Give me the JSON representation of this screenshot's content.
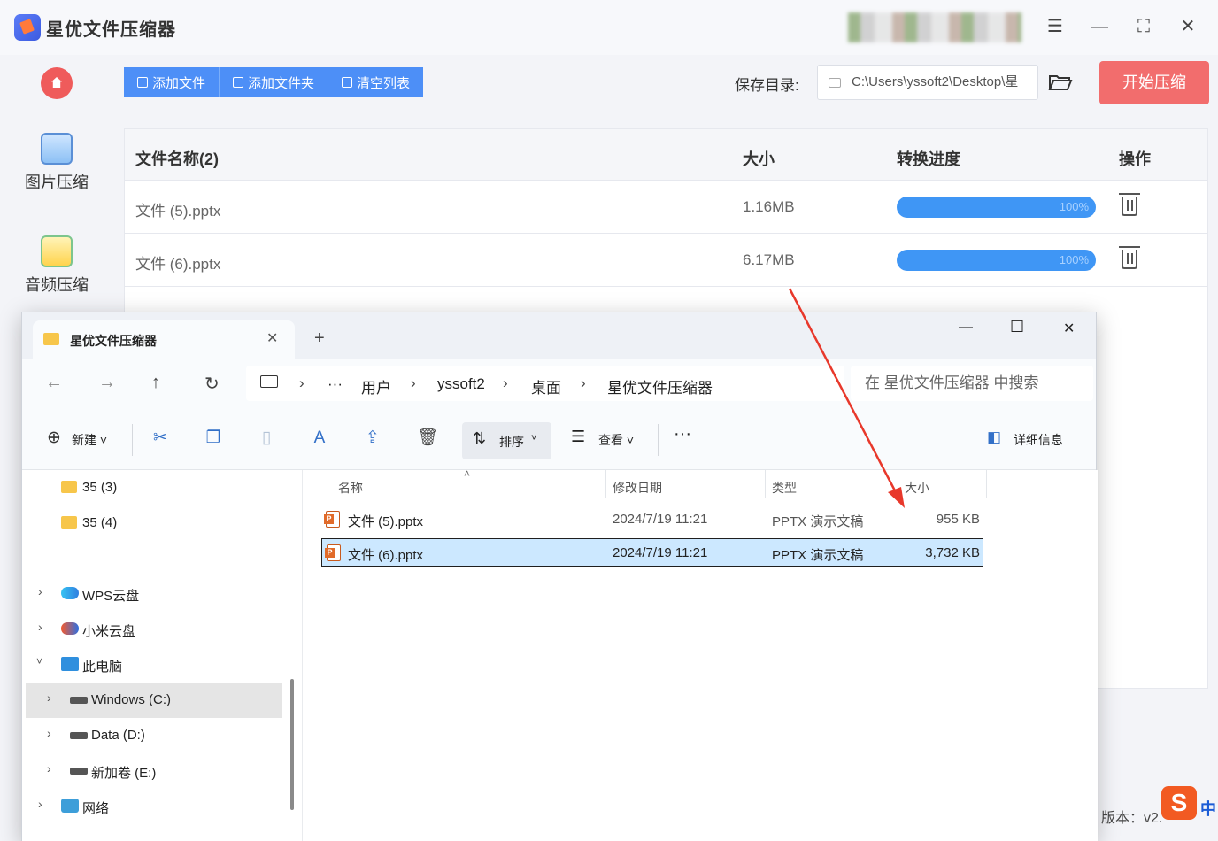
{
  "app": {
    "title": "星优文件压缩器",
    "sidebar": [
      {
        "label": "图片压缩",
        "icon": "image-icon"
      },
      {
        "label": "音频压缩",
        "icon": "audio-icon"
      }
    ],
    "toolbar": {
      "add_file": "添加文件",
      "add_folder": "添加文件夹",
      "clear_list": "清空列表"
    },
    "save_dir_label": "保存目录:",
    "save_dir_value": "C:\\Users\\yssoft2\\Desktop\\星",
    "start_button": "开始压缩",
    "table": {
      "headers": [
        "文件名称(2)",
        "大小",
        "转换进度",
        "操作"
      ],
      "rows": [
        {
          "name": "文件 (5).pptx",
          "size": "1.16MB",
          "progress": "100%"
        },
        {
          "name": "文件 (6).pptx",
          "size": "6.17MB",
          "progress": "100%"
        }
      ]
    },
    "version_label": "版本：v2.",
    "ime": {
      "logo": "S",
      "mode": "中"
    }
  },
  "explorer": {
    "tab_title": "星优文件压缩器",
    "breadcrumb": [
      "用户",
      "yssoft2",
      "桌面",
      "星优文件压缩器"
    ],
    "breadcrumb_more": "···",
    "search_placeholder": "在 星优文件压缩器 中搜索",
    "commands": {
      "new": "新建",
      "sort": "排序",
      "view": "查看",
      "more": "···",
      "details": "详细信息"
    },
    "nav": {
      "folders": [
        "35 (3)",
        "35 (4)"
      ],
      "items": [
        {
          "label": "WPS云盘"
        },
        {
          "label": "小米云盘"
        },
        {
          "label": "此电脑"
        },
        {
          "label": "Windows (C:)"
        },
        {
          "label": "Data (D:)"
        },
        {
          "label": "新加卷 (E:)"
        },
        {
          "label": "网络"
        }
      ]
    },
    "columns": [
      "名称",
      "修改日期",
      "类型",
      "大小"
    ],
    "files": [
      {
        "name": "文件 (5).pptx",
        "date": "2024/7/19 11:21",
        "type": "PPTX 演示文稿",
        "size": "955 KB"
      },
      {
        "name": "文件 (6).pptx",
        "date": "2024/7/19 11:21",
        "type": "PPTX 演示文稿",
        "size": "3,732 KB",
        "selected": true
      }
    ]
  },
  "colors": {
    "accent_blue": "#4d8ff7",
    "start_red": "#f26d6d",
    "progress_blue": "#3f96f5",
    "annotation_arrow": "#e8382b"
  }
}
